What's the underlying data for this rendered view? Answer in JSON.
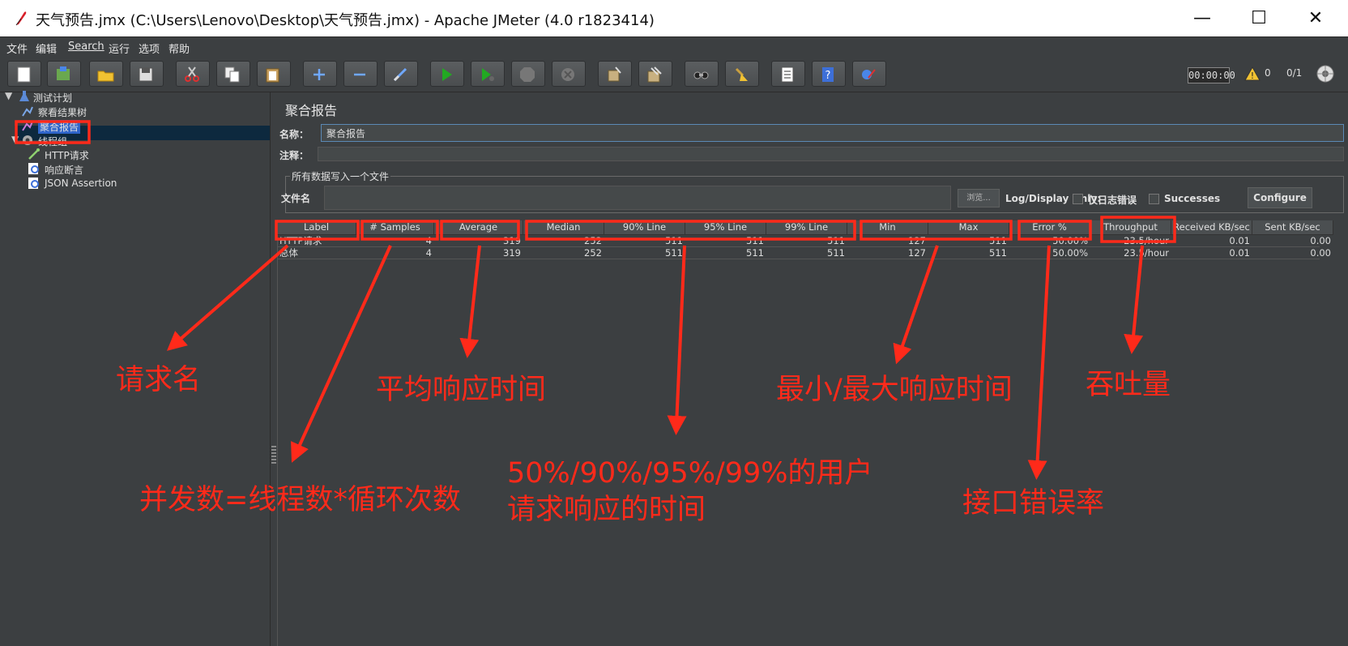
{
  "window": {
    "title": "天气预告.jmx (C:\\Users\\Lenovo\\Desktop\\天气预告.jmx) - Apache JMeter (4.0 r1823414)",
    "minimize": "—",
    "maximize": "☐",
    "close": "✕"
  },
  "menu": [
    "文件",
    "编辑",
    "Search",
    "运行",
    "选项",
    "帮助"
  ],
  "toolbar": {
    "timer": "00:00:00",
    "warnings": "0",
    "threads": "0/1",
    "buttons": [
      "new-icon",
      "templates-icon",
      "open-icon",
      "save-icon",
      "cut-icon",
      "copy-icon",
      "paste-icon",
      "expand-icon",
      "collapse-icon",
      "toggle-icon",
      "start-icon",
      "start-no-pause-icon",
      "stop-icon",
      "shutdown-icon",
      "clear-icon",
      "clear-all-icon",
      "search-icon",
      "reset-search-icon",
      "function-helper-icon",
      "help-icon",
      "remote-icon"
    ]
  },
  "tree": {
    "items": [
      {
        "label": "测试计划"
      },
      {
        "label": "察看结果树"
      },
      {
        "label": "聚合报告"
      },
      {
        "label": "线程组"
      },
      {
        "label": "HTTP请求"
      },
      {
        "label": "响应断言"
      },
      {
        "label": "JSON Assertion"
      }
    ]
  },
  "panel": {
    "title": "聚合报告",
    "name_label": "名称：",
    "name_value": "聚合报告",
    "comment_label": "注释：",
    "file_group": "所有数据写入一个文件",
    "filename_label": "文件名",
    "browse": "浏览...",
    "log_only": "Log/Display Only:",
    "errors_only": "仅日志错误",
    "successes": "Successes",
    "configure": "Configure"
  },
  "table": {
    "headers": [
      "Label",
      "# Samples",
      "Average",
      "Median",
      "90% Line",
      "95% Line",
      "99% Line",
      "Min",
      "Max",
      "Error %",
      "Throughput",
      "Received KB/sec",
      "Sent KB/sec"
    ],
    "rows": [
      [
        "HTTP请求",
        "4",
        "319",
        "252",
        "511",
        "511",
        "511",
        "127",
        "511",
        "50.00%",
        "23.5/hour",
        "0.01",
        "0.00"
      ],
      [
        "总体",
        "4",
        "319",
        "252",
        "511",
        "511",
        "511",
        "127",
        "511",
        "50.00%",
        "23.5/hour",
        "0.01",
        "0.00"
      ]
    ]
  },
  "annotations": {
    "label": "请求名",
    "samples": "并发数=线程数*循环次数",
    "average": "平均响应时间",
    "percentiles_line1": "50%/90%/95%/99%的用户",
    "percentiles_line2": "请求响应的时间",
    "minmax": "最小/最大响应时间",
    "error": "接口错误率",
    "throughput": "吞吐量",
    "color": "#ff2a1a"
  }
}
